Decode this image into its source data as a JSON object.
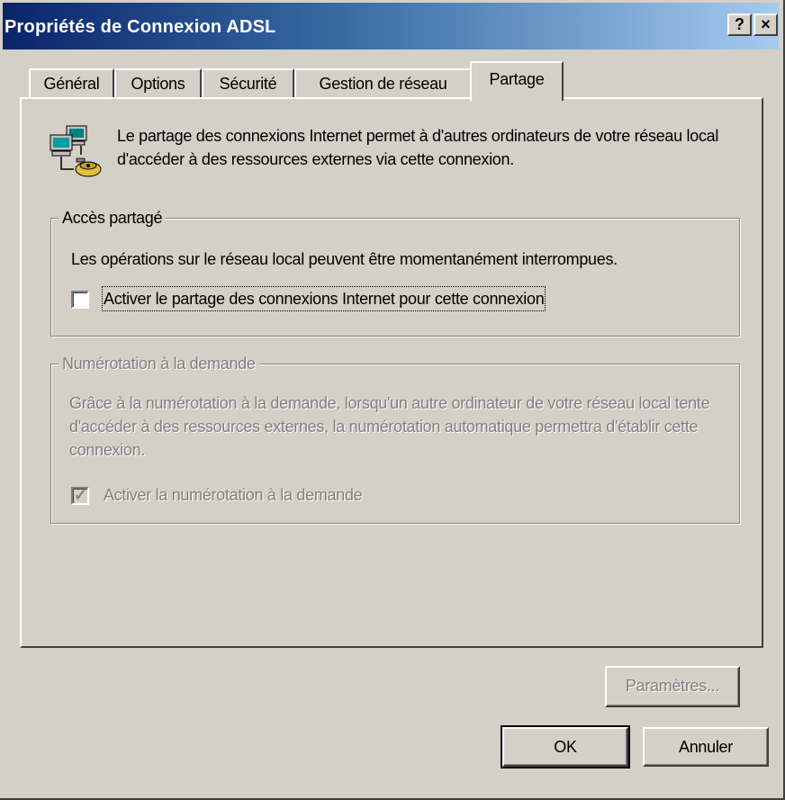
{
  "window": {
    "title": "Propriétés de Connexion ADSL",
    "help_button": "?",
    "close_button": "×"
  },
  "tabs": [
    {
      "label": "Général"
    },
    {
      "label": "Options"
    },
    {
      "label": "Sécurité"
    },
    {
      "label": "Gestion de réseau"
    },
    {
      "label": "Partage",
      "active": true
    }
  ],
  "panel": {
    "intro_icon": "network-connection-icon",
    "intro_text": "Le partage des connexions Internet permet à d'autres ordinateurs de votre réseau local d'accéder à des ressources externes via cette connexion.",
    "shared_access": {
      "legend": "Accès partagé",
      "warning": "Les opérations sur le réseau local peuvent être momentanément interrompues.",
      "checkbox_label": "Activer le partage des connexions Internet pour cette connexion",
      "checked": false
    },
    "on_demand": {
      "legend": "Numérotation à la demande",
      "description": "Grâce à la numérotation à la demande, lorsqu'un autre ordinateur de votre réseau local tente d'accéder à des ressources externes, la numérotation automatique permettra d'établir cette connexion.",
      "checkbox_label": "Activer la numérotation à la demande",
      "checked": true,
      "enabled": false
    },
    "settings_button": "Paramètres..."
  },
  "footer": {
    "ok_label": "OK",
    "cancel_label": "Annuler"
  }
}
